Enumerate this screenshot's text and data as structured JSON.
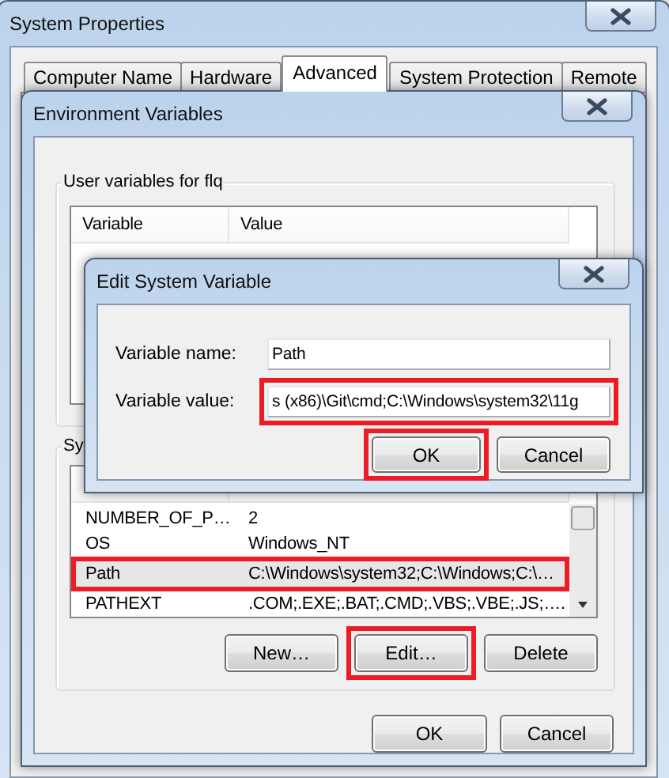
{
  "window": {
    "title": "System Properties"
  },
  "tabs": [
    {
      "label": "Computer Name",
      "selected": false
    },
    {
      "label": "Hardware",
      "selected": false
    },
    {
      "label": "Advanced",
      "selected": true
    },
    {
      "label": "System Protection",
      "selected": false
    },
    {
      "label": "Remote",
      "selected": false
    }
  ],
  "environment_dialog": {
    "title": "Environment Variables",
    "user_variables": {
      "label": "User variables for flq",
      "columns": [
        "Variable",
        "Value"
      ]
    },
    "system_variables": {
      "label": "Sy",
      "rows": [
        {
          "variable": "NUMBER_OF_P…",
          "value": "2",
          "selected": false,
          "highlighted": false
        },
        {
          "variable": "OS",
          "value": "Windows_NT",
          "selected": false,
          "highlighted": false
        },
        {
          "variable": "Path",
          "value": "C:\\Windows\\system32;C:\\Windows;C:\\…",
          "selected": true,
          "highlighted": true
        },
        {
          "variable": "PATHEXT",
          "value": ".COM;.EXE;.BAT;.CMD;.VBS;.VBE;.JS;….",
          "selected": false,
          "highlighted": false
        }
      ],
      "buttons": [
        {
          "label": "New…",
          "highlighted": false
        },
        {
          "label": "Edit…",
          "highlighted": true
        },
        {
          "label": "Delete",
          "highlighted": false
        }
      ]
    },
    "buttons": [
      {
        "label": "OK",
        "highlighted": false
      },
      {
        "label": "Cancel",
        "highlighted": false
      }
    ]
  },
  "edit_dialog": {
    "title": "Edit System Variable",
    "fields": [
      {
        "label": "Variable name:",
        "value": "Path",
        "highlighted": false
      },
      {
        "label": "Variable value:",
        "value": "s (x86)\\Git\\cmd;C:\\Windows\\system32\\11g",
        "highlighted": true
      }
    ],
    "buttons": [
      {
        "label": "OK",
        "highlighted": true
      },
      {
        "label": "Cancel",
        "highlighted": false
      }
    ]
  }
}
